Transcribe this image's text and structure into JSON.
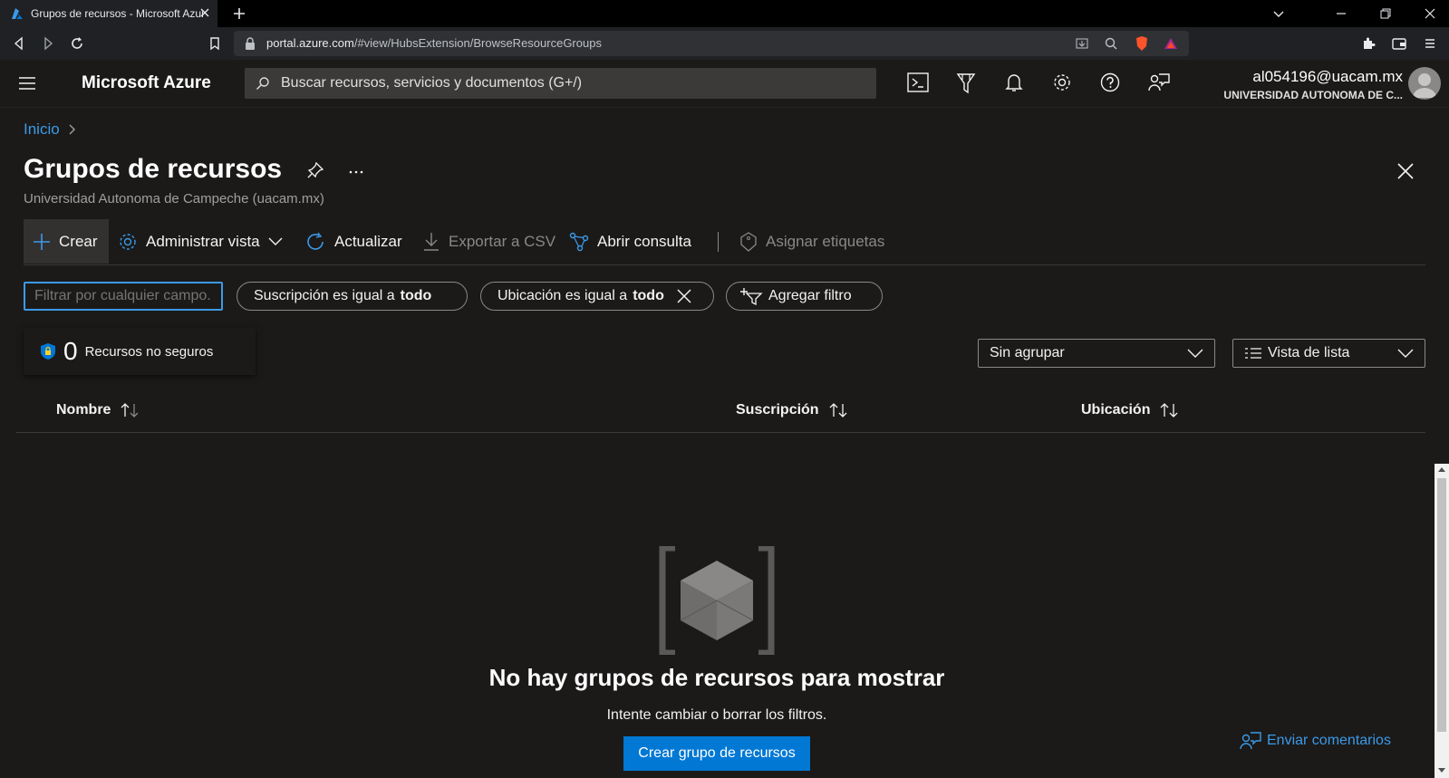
{
  "browser": {
    "tab_title": "Grupos de recursos - Microsoft Azure",
    "url_host": "portal.azure.com",
    "url_path": "/#view/HubsExtension/BrowseResourceGroups"
  },
  "header": {
    "brand": "Microsoft Azure",
    "search_placeholder": "Buscar recursos, servicios y documentos (G+/)",
    "user_email": "al054196@uacam.mx",
    "user_org": "UNIVERSIDAD AUTONOMA DE C..."
  },
  "breadcrumb": {
    "home": "Inicio"
  },
  "page": {
    "title": "Grupos de recursos",
    "subtitle": "Universidad Autonoma de Campeche (uacam.mx)"
  },
  "commands": {
    "create": "Crear",
    "manage_view": "Administrar vista",
    "refresh": "Actualizar",
    "export_csv": "Exportar a CSV",
    "open_query": "Abrir consulta",
    "assign_tags": "Asignar etiquetas"
  },
  "filters": {
    "input_placeholder": "Filtrar por cualquier campo...",
    "subscription_prefix": "Suscripción es igual a",
    "subscription_value": "todo",
    "location_prefix": "Ubicación es igual a",
    "location_value": "todo",
    "add_filter": "Agregar filtro"
  },
  "security": {
    "count": "0",
    "label": "Recursos no seguros"
  },
  "grouping": {
    "selected": "Sin agrupar"
  },
  "view": {
    "selected": "Vista de lista"
  },
  "table": {
    "columns": [
      "Nombre",
      "Suscripción",
      "Ubicación"
    ]
  },
  "empty_state": {
    "title": "No hay grupos de recursos para mostrar",
    "subtitle": "Intente cambiar o borrar los filtros.",
    "button": "Crear grupo de recursos"
  },
  "feedback": {
    "label": "Enviar comentarios"
  },
  "colors": {
    "accent": "#0078d4",
    "link": "#3b9ae8",
    "background": "#1b1a19"
  }
}
